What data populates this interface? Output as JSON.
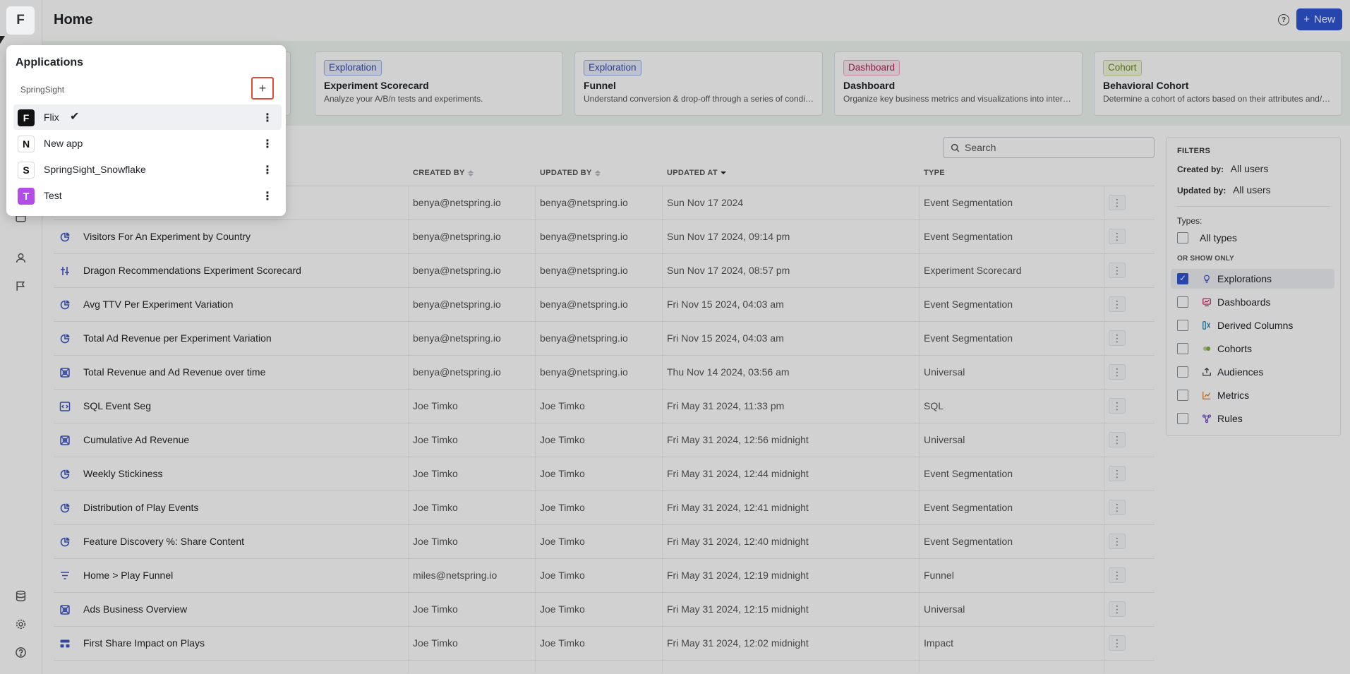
{
  "sidebar": {
    "logo_letter": "F"
  },
  "header": {
    "title": "Home",
    "help_label": "?",
    "new_button": {
      "icon": "+",
      "label": "New"
    }
  },
  "templates": [
    {
      "badge": "Exploration",
      "badge_style": "expl",
      "title": "Experiment Scorecard",
      "description": "Analyze your A/B/n tests and experiments."
    },
    {
      "badge": "Exploration",
      "badge_style": "expl",
      "title": "Funnel",
      "description": "Understand conversion & drop-off through a series of conditi..."
    },
    {
      "badge": "Dashboard",
      "badge_style": "dash",
      "title": "Dashboard",
      "description": "Organize key business metrics and visualizations into interacti..."
    },
    {
      "badge": "Cohort",
      "badge_style": "coh",
      "title": "Behavioral Cohort",
      "description": "Determine a cohort of actors based on their attributes and/or ..."
    }
  ],
  "search": {
    "placeholder": "Search"
  },
  "table": {
    "columns": {
      "created_by": "CREATED BY",
      "updated_by": "UPDATED BY",
      "updated_at": "UPDATED AT",
      "type": "TYPE"
    },
    "rows": [
      {
        "icon": "segmentation-icon",
        "name": "",
        "created_by": "benya@netspring.io",
        "updated_by": "benya@netspring.io",
        "updated_at": "Sun Nov 17 2024",
        "type": "Event Segmentation"
      },
      {
        "icon": "segmentation-icon",
        "name": "Visitors For An Experiment by Country",
        "created_by": "benya@netspring.io",
        "updated_by": "benya@netspring.io",
        "updated_at": "Sun Nov 17 2024, 09:14 pm",
        "type": "Event Segmentation"
      },
      {
        "icon": "scorecard-icon",
        "name": "Dragon Recommendations Experiment Scorecard",
        "created_by": "benya@netspring.io",
        "updated_by": "benya@netspring.io",
        "updated_at": "Sun Nov 17 2024, 08:57 pm",
        "type": "Experiment Scorecard"
      },
      {
        "icon": "segmentation-icon",
        "name": "Avg TTV Per Experiment Variation",
        "created_by": "benya@netspring.io",
        "updated_by": "benya@netspring.io",
        "updated_at": "Fri Nov 15 2024, 04:03 am",
        "type": "Event Segmentation"
      },
      {
        "icon": "segmentation-icon",
        "name": "Total Ad Revenue per Experiment Variation",
        "created_by": "benya@netspring.io",
        "updated_by": "benya@netspring.io",
        "updated_at": "Fri Nov 15 2024, 04:03 am",
        "type": "Event Segmentation"
      },
      {
        "icon": "universal-icon",
        "name": "Total Revenue and Ad Revenue over time",
        "created_by": "benya@netspring.io",
        "updated_by": "benya@netspring.io",
        "updated_at": "Thu Nov 14 2024, 03:56 am",
        "type": "Universal"
      },
      {
        "icon": "sql-icon",
        "name": "SQL Event Seg",
        "created_by": "Joe Timko",
        "updated_by": "Joe Timko",
        "updated_at": "Fri May 31 2024, 11:33 pm",
        "type": "SQL"
      },
      {
        "icon": "universal-icon",
        "name": "Cumulative Ad Revenue",
        "created_by": "Joe Timko",
        "updated_by": "Joe Timko",
        "updated_at": "Fri May 31 2024, 12:56 midnight",
        "type": "Universal"
      },
      {
        "icon": "segmentation-icon",
        "name": "Weekly Stickiness",
        "created_by": "Joe Timko",
        "updated_by": "Joe Timko",
        "updated_at": "Fri May 31 2024, 12:44 midnight",
        "type": "Event Segmentation"
      },
      {
        "icon": "segmentation-icon",
        "name": "Distribution of Play Events",
        "created_by": "Joe Timko",
        "updated_by": "Joe Timko",
        "updated_at": "Fri May 31 2024, 12:41 midnight",
        "type": "Event Segmentation"
      },
      {
        "icon": "segmentation-icon",
        "name": "Feature Discovery %: Share Content",
        "created_by": "Joe Timko",
        "updated_by": "Joe Timko",
        "updated_at": "Fri May 31 2024, 12:40 midnight",
        "type": "Event Segmentation"
      },
      {
        "icon": "funnel-icon",
        "name": "Home > Play Funnel",
        "created_by": "miles@netspring.io",
        "updated_by": "Joe Timko",
        "updated_at": "Fri May 31 2024, 12:19 midnight",
        "type": "Funnel"
      },
      {
        "icon": "universal-icon",
        "name": "Ads Business Overview",
        "created_by": "Joe Timko",
        "updated_by": "Joe Timko",
        "updated_at": "Fri May 31 2024, 12:15 midnight",
        "type": "Universal"
      },
      {
        "icon": "impact-icon",
        "name": "First Share Impact on Plays",
        "created_by": "Joe Timko",
        "updated_by": "Joe Timko",
        "updated_at": "Fri May 31 2024, 12:02 midnight",
        "type": "Impact"
      }
    ]
  },
  "filters": {
    "title": "FILTERS",
    "created_by_label": "Created by:",
    "created_by_value": "All users",
    "updated_by_label": "Updated by:",
    "updated_by_value": "All users",
    "types_label": "Types:",
    "all_types_label": "All types",
    "show_only_label": "OR SHOW ONLY",
    "items": [
      {
        "label": "Explorations",
        "checked": true,
        "icon": "lightbulb-icon",
        "color": "#3d57c9"
      },
      {
        "label": "Dashboards",
        "checked": false,
        "icon": "dashboard-icon",
        "color": "#c2185b"
      },
      {
        "label": "Derived Columns",
        "checked": false,
        "icon": "derived-column-icon",
        "color": "#1a7fa6"
      },
      {
        "label": "Cohorts",
        "checked": false,
        "icon": "cohort-icon",
        "color": "#7cb342"
      },
      {
        "label": "Audiences",
        "checked": false,
        "icon": "audience-icon",
        "color": "#333333"
      },
      {
        "label": "Metrics",
        "checked": false,
        "icon": "metric-icon",
        "color": "#e07b1f"
      },
      {
        "label": "Rules",
        "checked": false,
        "icon": "rules-icon",
        "color": "#6a3fc1"
      }
    ]
  },
  "applications_popover": {
    "title": "Applications",
    "org": "SpringSight",
    "add_label": "+",
    "apps": [
      {
        "letter": "F",
        "name": "Flix",
        "selected": true,
        "avatar_bg": "#111111",
        "avatar_fg": "#ffffff"
      },
      {
        "letter": "N",
        "name": "New app",
        "selected": false,
        "avatar_bg": "#ffffff",
        "avatar_fg": "#111111"
      },
      {
        "letter": "S",
        "name": "SpringSight_Snowflake",
        "selected": false,
        "avatar_bg": "#ffffff",
        "avatar_fg": "#111111"
      },
      {
        "letter": "T",
        "name": "Test",
        "selected": false,
        "avatar_bg": "#b24ee6",
        "avatar_fg": "#ffffff"
      }
    ]
  }
}
